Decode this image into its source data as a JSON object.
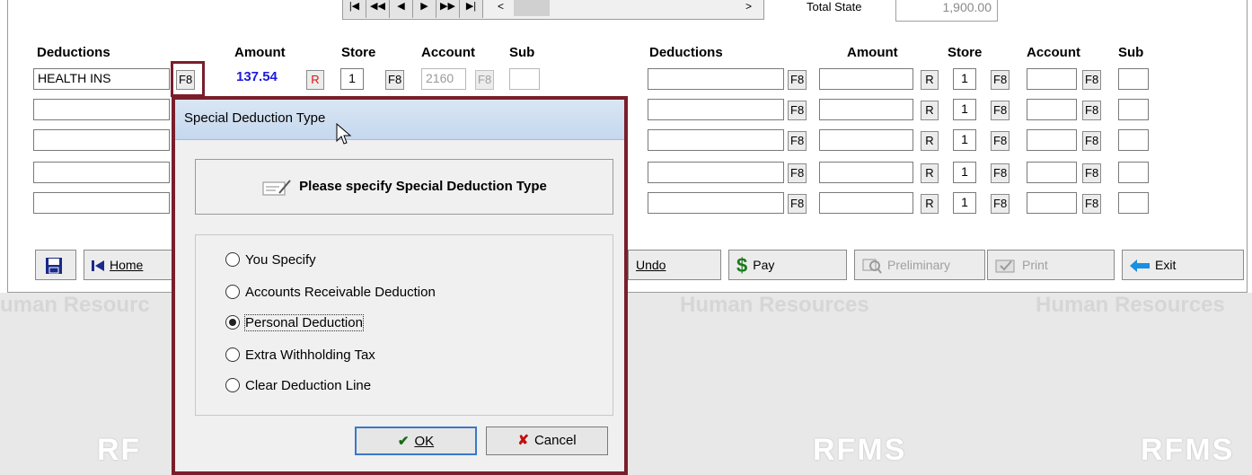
{
  "window": {
    "total_state_label": "Total State",
    "total_state_value": "1,900.00"
  },
  "headers": {
    "left": {
      "deductions": "Deductions",
      "amount": "Amount",
      "store": "Store",
      "account": "Account",
      "sub": "Sub"
    },
    "right": {
      "deductions": "Deductions",
      "amount": "Amount",
      "store": "Store",
      "account": "Account",
      "sub": "Sub"
    }
  },
  "left_rows": [
    {
      "deduction": "HEALTH INS",
      "f8": "F8",
      "amount": "137.54",
      "r": "R",
      "store": "1",
      "store_f8": "F8",
      "account": "2160",
      "account_f8": "F8",
      "sub": ""
    },
    {
      "deduction": ""
    },
    {
      "deduction": ""
    },
    {
      "deduction": ""
    },
    {
      "deduction": ""
    }
  ],
  "right_rows": [
    {
      "deduction": "",
      "f8": "F8",
      "amount": "",
      "r": "R",
      "store": "1",
      "store_f8": "F8",
      "account": "",
      "account_f8": "F8",
      "sub": ""
    },
    {
      "deduction": "",
      "f8": "F8",
      "amount": "",
      "r": "R",
      "store": "1",
      "store_f8": "F8",
      "account": "",
      "account_f8": "F8",
      "sub": ""
    },
    {
      "deduction": "",
      "f8": "F8",
      "amount": "",
      "r": "R",
      "store": "1",
      "store_f8": "F8",
      "account": "",
      "account_f8": "F8",
      "sub": ""
    },
    {
      "deduction": "",
      "f8": "F8",
      "amount": "",
      "r": "R",
      "store": "1",
      "store_f8": "F8",
      "account": "",
      "account_f8": "F8",
      "sub": ""
    },
    {
      "deduction": "",
      "f8": "F8",
      "amount": "",
      "r": "R",
      "store": "1",
      "store_f8": "F8",
      "account": "",
      "account_f8": "F8",
      "sub": ""
    }
  ],
  "toolbar": {
    "home": "Home",
    "undo": "Undo",
    "pay": "Pay",
    "preliminary": "Preliminary",
    "print": "Print",
    "exit": "Exit"
  },
  "watermark": {
    "text": "Human Resources",
    "text_left": "uman Resourc",
    "logo": "RFMS",
    "logo_left": "RF"
  },
  "dialog": {
    "title": "Special Deduction Type",
    "header": "Please specify Special Deduction Type",
    "options": [
      {
        "label": "You Specify",
        "selected": false
      },
      {
        "label": "Accounts Receivable Deduction",
        "selected": false
      },
      {
        "label": "Personal Deduction",
        "selected": true
      },
      {
        "label": "Extra Withholding Tax",
        "selected": false
      },
      {
        "label": "Clear Deduction Line",
        "selected": false
      }
    ],
    "ok": "OK",
    "cancel": "Cancel"
  },
  "colors": {
    "accent_border": "#7a1e2b",
    "amount_blue": "#1a1ae0",
    "r_red": "#e01010"
  }
}
